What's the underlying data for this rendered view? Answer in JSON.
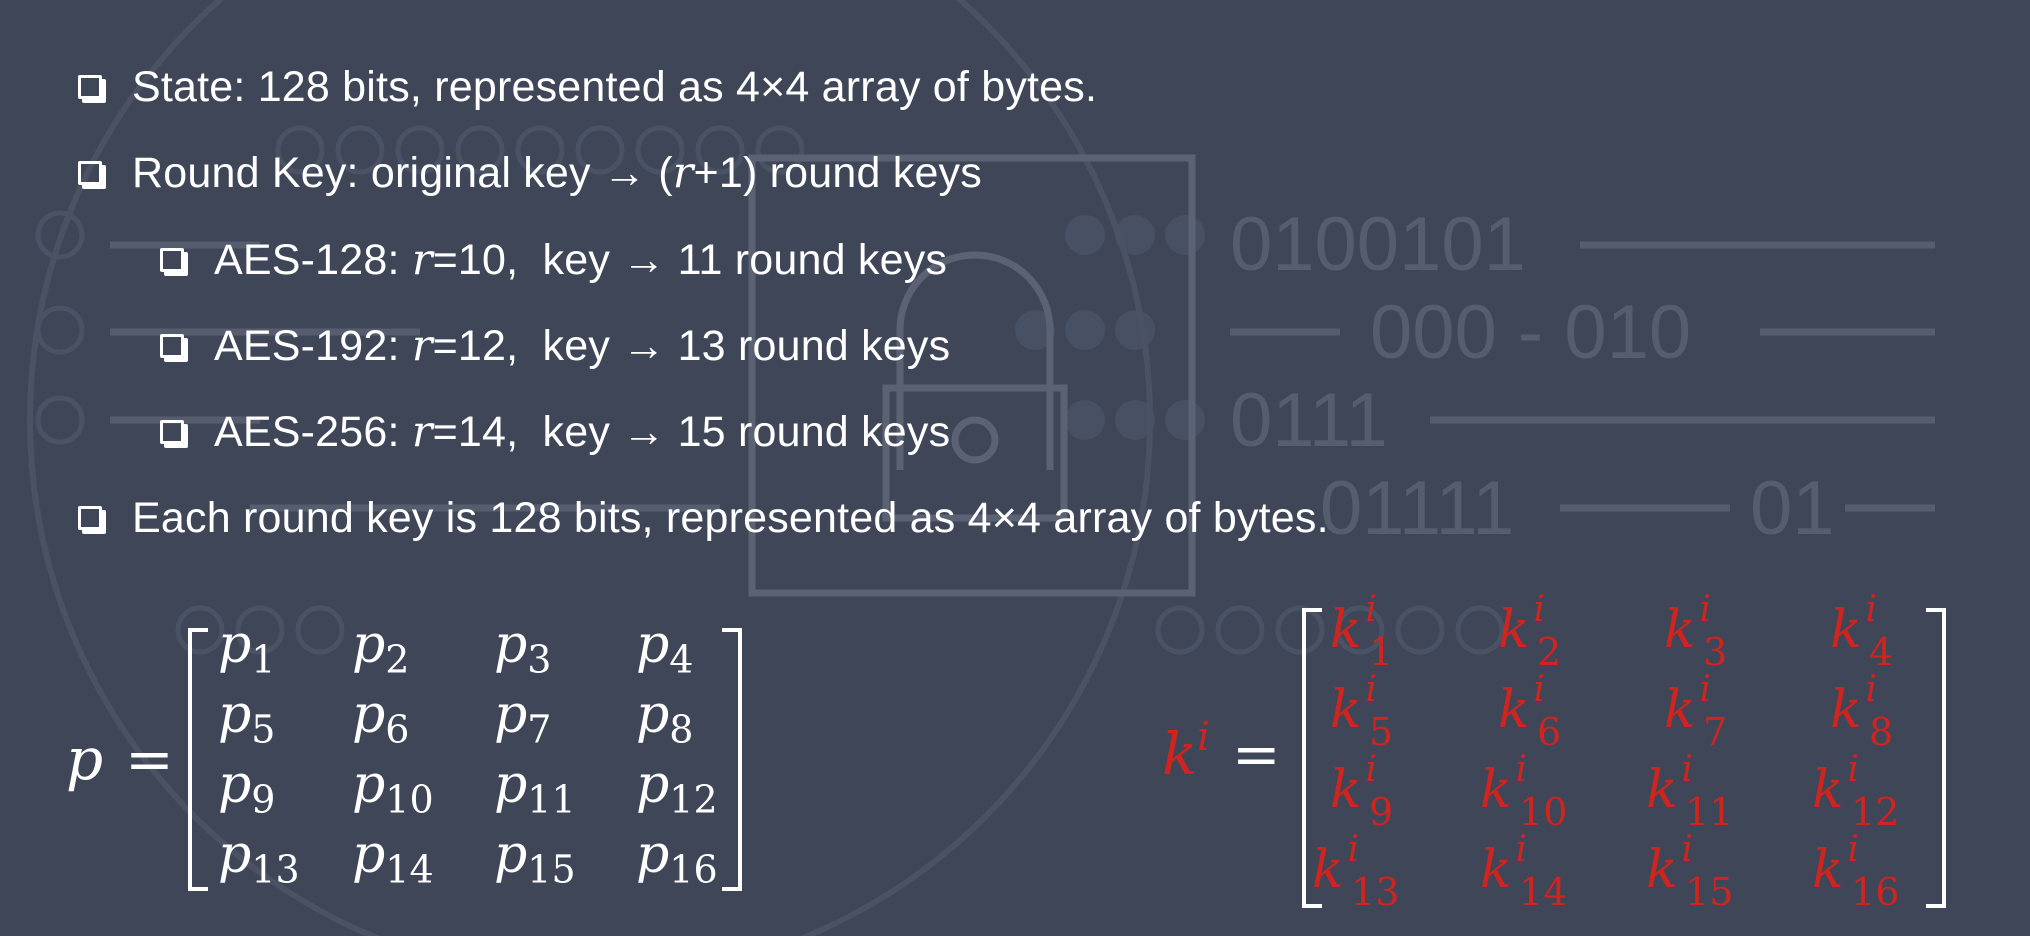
{
  "bullets": [
    {
      "level": 1,
      "text": "State: 128 bits, represented as 4×4 array of bytes."
    },
    {
      "level": 1,
      "pre": "Round Key: original key → (",
      "var": "r",
      "post": "+1) round keys"
    },
    {
      "level": 2,
      "pre": "AES-128: ",
      "var": "r",
      "post": "=10,  key → 11 round keys"
    },
    {
      "level": 2,
      "pre": "AES-192: ",
      "var": "r",
      "post": "=12,  key → 13 round keys"
    },
    {
      "level": 2,
      "pre": "AES-256: ",
      "var": "r",
      "post": "=14,  key → 15 round keys"
    },
    {
      "level": 1,
      "text": "Each round key is 128 bits, represented as 4×4 array of bytes."
    }
  ],
  "state_matrix": {
    "lhs": "p",
    "equals": "=",
    "symbol": "p",
    "subscripts": [
      "1",
      "2",
      "3",
      "4",
      "5",
      "6",
      "7",
      "8",
      "9",
      "10",
      "11",
      "12",
      "13",
      "14",
      "15",
      "16"
    ],
    "color": "#ffffff"
  },
  "key_matrix": {
    "lhs": "k",
    "lhs_sup": "i",
    "equals": "=",
    "symbol": "k",
    "superscript": "i",
    "subscripts": [
      "1",
      "2",
      "3",
      "4",
      "5",
      "6",
      "7",
      "8",
      "9",
      "10",
      "11",
      "12",
      "13",
      "14",
      "15",
      "16"
    ],
    "color": "#d0241f"
  },
  "background": {
    "binary_lines": [
      "0100101",
      "000 - 010",
      "0111",
      "01111",
      "01"
    ],
    "color": "#3f4658"
  }
}
